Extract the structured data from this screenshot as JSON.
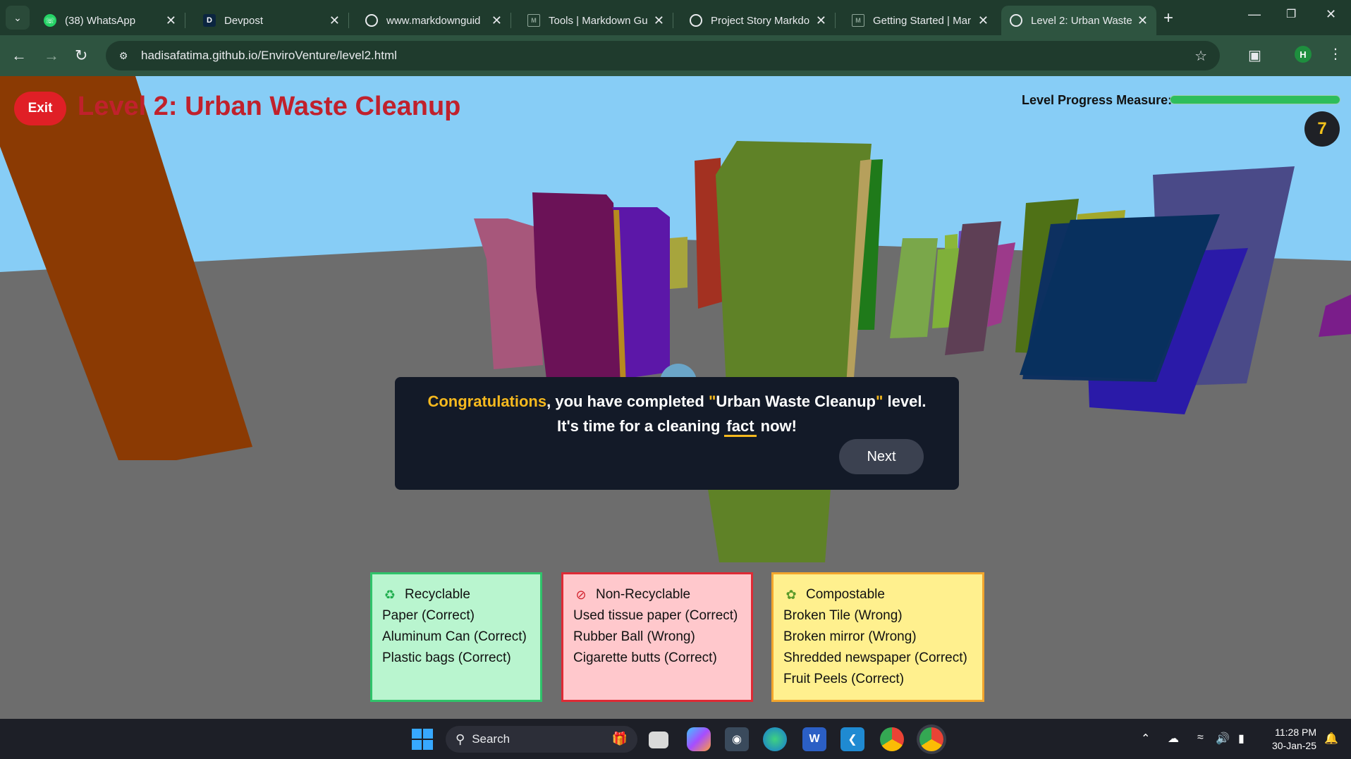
{
  "browser": {
    "tabs": [
      {
        "title": "(38) WhatsApp",
        "icon": "whatsapp-icon",
        "active": false
      },
      {
        "title": "Devpost",
        "icon": "devpost-icon",
        "active": false
      },
      {
        "title": "www.markdownguid",
        "icon": "globe-icon",
        "active": false
      },
      {
        "title": "Tools | Markdown Gu",
        "icon": "markdown-icon",
        "active": false
      },
      {
        "title": "Project Story Markdo",
        "icon": "openai-icon",
        "active": false
      },
      {
        "title": "Getting Started | Mar",
        "icon": "markdown-icon",
        "active": false
      },
      {
        "title": "Level 2: Urban Waste",
        "icon": "globe-icon",
        "active": true
      }
    ],
    "url": "hadisafatima.github.io/EnviroVenture/level2.html",
    "profile_initial": "H"
  },
  "game": {
    "exit_label": "Exit",
    "title": "Level 2: Urban Waste Cleanup",
    "progress_label": "Level Progress Measure:",
    "progress_fraction": 1.0,
    "score": "7",
    "dialog": {
      "congrats": "Congratulations",
      "text_a": ", you have completed ",
      "quote_open": "\"",
      "level_name": "Urban Waste Cleanup",
      "quote_close": "\"",
      "text_b": " level.",
      "line2_prefix": "It's time for a cleaning",
      "fact_word": "fact",
      "line2_suffix": " now!",
      "next_label": "Next"
    },
    "bins": {
      "recyclable": {
        "title": "Recyclable",
        "icon": "recycle-icon",
        "items": [
          "Paper (Correct)",
          "Aluminum Can (Correct)",
          "Plastic bags (Correct)"
        ]
      },
      "non_recyclable": {
        "title": "Non-Recyclable",
        "icon": "no-recycle-icon",
        "items": [
          "Used tissue paper (Correct)",
          "Rubber Ball (Wrong)",
          "Cigarette butts (Correct)"
        ]
      },
      "compostable": {
        "title": "Compostable",
        "icon": "leaf-icon",
        "items": [
          "Broken Tile (Wrong)",
          "Broken mirror (Wrong)",
          "Shredded newspaper (Correct)",
          "Fruit Peels (Correct)"
        ]
      }
    }
  },
  "taskbar": {
    "search_label": "Search",
    "time": "11:28 PM",
    "date": "30-Jan-25"
  },
  "colors": {
    "exit_button": "#e01f26",
    "title": "#c0212c",
    "progress": "#2ebd5b",
    "dialog_bg": "#131a28",
    "highlight": "#f6b91e"
  }
}
